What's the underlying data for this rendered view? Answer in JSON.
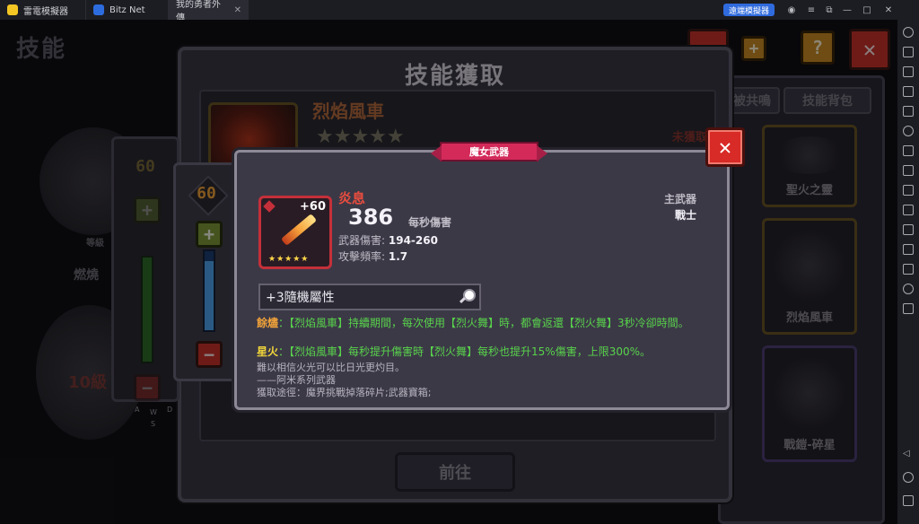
{
  "titlebar": {
    "tabs": [
      {
        "label": "雷電模擬器"
      },
      {
        "label": "Bitz Net"
      },
      {
        "label": "我的勇者外傳"
      }
    ],
    "speed_button": "遠端模擬器"
  },
  "background": {
    "page_title": "技能",
    "level_label": "等級",
    "skill_label": "燃燒",
    "level_badge": "10級",
    "side_level": "60",
    "keys": {
      "w": "W",
      "a": "A",
      "d": "D",
      "s": "S"
    }
  },
  "list_panel": {
    "tab_resonance": "被共鳴",
    "tab_skillbag": "技能背包",
    "cards": [
      {
        "name": "聖火之靈"
      },
      {
        "name": "烈焰風車"
      },
      {
        "name": "戰鎧-碎星"
      }
    ]
  },
  "acquire_dialog": {
    "title": "技能獲取",
    "skill_name": "烈焰風車",
    "stars": "★★★★★",
    "status": "未獲取",
    "goto_button": "前往"
  },
  "level_panel": {
    "level": "60",
    "slider_fraction": 0.88
  },
  "weapon_popup": {
    "ribbon": "魔女武器",
    "close": "✕",
    "upgrade": "+60",
    "mini_stars": "★★★★★",
    "name": "炎息",
    "dps_value": "386",
    "dps_label": "每秒傷害",
    "damage_label": "武器傷害:",
    "damage_value": "194-260",
    "freq_label": "攻擊頻率:",
    "freq_value": "1.7",
    "slot": "主武器",
    "class": "戰士",
    "random_attr": "+3隨機屬性",
    "effects": [
      {
        "key": "餘燼",
        "text": "：【烈焰風車】持續期間，每次使用【烈火舞】時，都會返還【烈火舞】3秒冷卻時間。"
      },
      {
        "key": "星火",
        "text": "：【烈焰風車】每秒提升傷害時【烈火舞】每秒也提升15%傷害，上限300%。"
      }
    ],
    "flavor": [
      "難以相信火光可以比日光更灼目。",
      "——阿米系列武器",
      "獲取途徑：魔界挑戰掉落碎片;武器寶箱;"
    ]
  },
  "colors": {
    "rarity_red": "#c4303a",
    "effect_green": "#58d34b",
    "effect_key_orange": "#f0a23a",
    "level_orange": "#f0a23a"
  }
}
